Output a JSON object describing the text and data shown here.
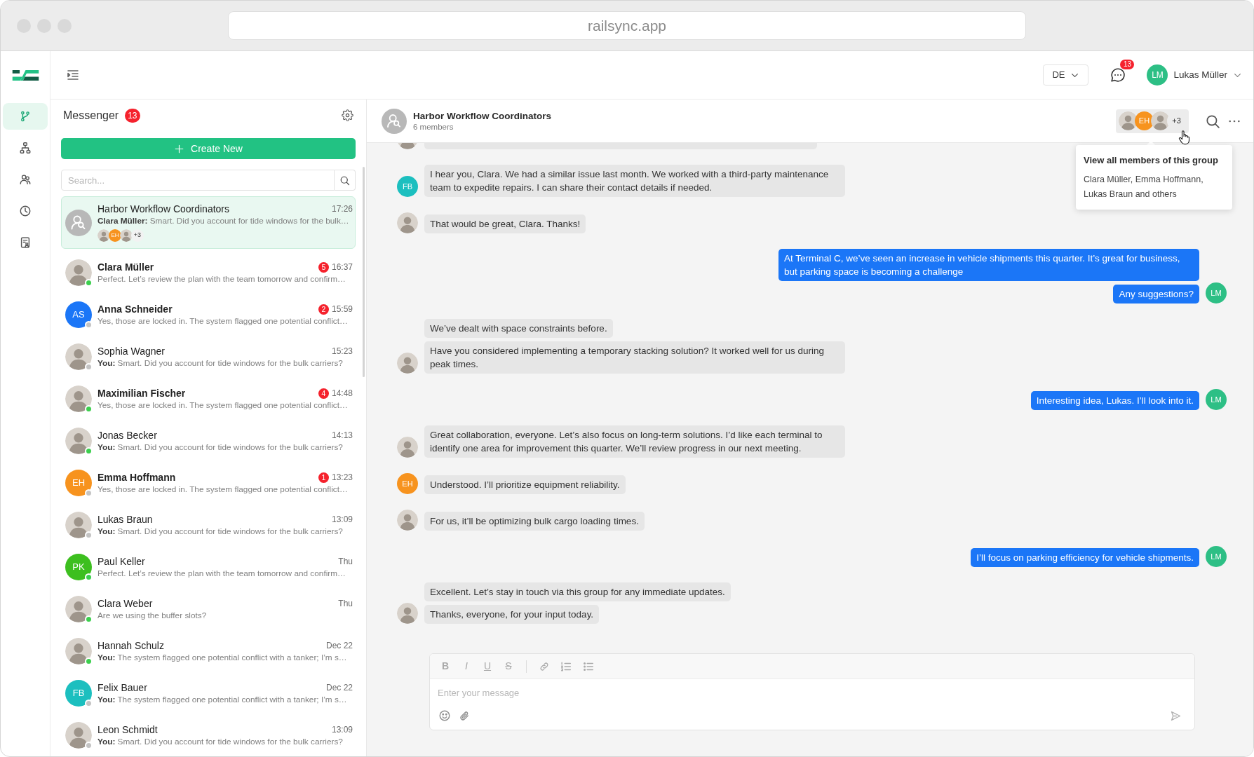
{
  "browser": {
    "url": "railsync.app"
  },
  "nav_rail": {
    "items": [
      {
        "selected": true
      },
      {
        "selected": false
      },
      {
        "selected": false
      },
      {
        "selected": false
      },
      {
        "selected": false
      }
    ]
  },
  "top_bar": {
    "language": "DE",
    "notifications": "13",
    "user": {
      "initials": "LM",
      "name": "Lukas Müller"
    }
  },
  "messenger": {
    "title": "Messenger",
    "unread": "13",
    "create_label": "Create New",
    "search": {
      "placeholder": "Search..."
    },
    "conversations": [
      {
        "kind": "group",
        "selected": true,
        "name": "Harbor Workflow Coordinators",
        "time": "17:26",
        "preview": "**Clara Müller:** Smart. Did you account for tide windows for the bulk…",
        "avatar": {
          "kind": "group"
        },
        "members_preview": {
          "avatars": [
            {
              "kind": "photo"
            },
            {
              "kind": "initials",
              "initials": "EH",
              "color": "#f7931e"
            },
            {
              "kind": "photo"
            }
          ],
          "more": "+3"
        }
      },
      {
        "kind": "direct",
        "selected": false,
        "online": true,
        "name": "Clara Müller",
        "unread": "5",
        "time": "16:37",
        "preview": "Perfect. Let’s review the plan with the team tomorrow and confirm…",
        "avatar": {
          "kind": "photo"
        }
      },
      {
        "kind": "direct",
        "selected": false,
        "online": false,
        "name": "Anna Schneider",
        "unread": "2",
        "time": "15:59",
        "preview": "Yes, those are locked in. The system flagged one potential conflict…",
        "avatar": {
          "kind": "initials",
          "initials": "AS",
          "color": "#1b76f7"
        }
      },
      {
        "kind": "direct",
        "selected": false,
        "online": false,
        "name": "Sophia Wagner",
        "time": "15:23",
        "preview": "**You:** Smart. Did you account for tide windows for the bulk carriers?",
        "avatar": {
          "kind": "photo"
        }
      },
      {
        "kind": "direct",
        "selected": false,
        "online": true,
        "name": "Maximilian Fischer",
        "unread": "4",
        "time": "14:48",
        "preview": "Yes, those are locked in. The system flagged one potential conflict…",
        "avatar": {
          "kind": "photo"
        }
      },
      {
        "kind": "direct",
        "selected": false,
        "online": true,
        "name": "Jonas Becker",
        "time": "14:13",
        "preview": "**You:** Smart. Did you account for tide windows for the bulk carriers?",
        "avatar": {
          "kind": "photo"
        }
      },
      {
        "kind": "direct",
        "selected": false,
        "online": false,
        "name": "Emma Hoffmann",
        "unread": "1",
        "time": "13:23",
        "preview": "Yes, those are locked in. The system flagged one potential conflict…",
        "avatar": {
          "kind": "initials",
          "initials": "EH",
          "color": "#f7931e"
        }
      },
      {
        "kind": "direct",
        "selected": false,
        "online": false,
        "name": "Lukas Braun",
        "time": "13:09",
        "preview": "**You:** Smart. Did you account for tide windows for the bulk carriers?",
        "avatar": {
          "kind": "photo"
        }
      },
      {
        "kind": "direct",
        "selected": false,
        "online": true,
        "name": "Paul Keller",
        "time": "Thu",
        "preview": "Perfect. Let’s review the plan with the team tomorrow and confirm…",
        "avatar": {
          "kind": "initials",
          "initials": "PK",
          "color": "#3dbf1f"
        }
      },
      {
        "kind": "direct",
        "selected": false,
        "online": true,
        "name": "Clara Weber",
        "time": "Thu",
        "preview": "Are we using the buffer slots?",
        "avatar": {
          "kind": "photo"
        }
      },
      {
        "kind": "direct",
        "selected": false,
        "online": true,
        "name": "Hannah Schulz",
        "time": "Dec 22",
        "preview": "**You:** The system flagged one potential conflict with a tanker; I’m s…",
        "avatar": {
          "kind": "photo"
        }
      },
      {
        "kind": "direct",
        "selected": false,
        "online": false,
        "name": "Felix Bauer",
        "time": "Dec 22",
        "preview": "**You:** The system flagged one potential conflict with a tanker; I’m s…",
        "avatar": {
          "kind": "initials",
          "initials": "FB",
          "color": "#1cbfbf"
        }
      },
      {
        "kind": "direct",
        "selected": false,
        "online": false,
        "name": "Leon Schmidt",
        "time": "13:09",
        "preview": "**You:** Smart. Did you account for tide windows for the bulk carriers?",
        "avatar": {
          "kind": "photo"
        }
      }
    ]
  },
  "chat": {
    "title": "Harbor Workflow Coordinators",
    "subtitle": "6 members",
    "members": {
      "avatars": [
        {
          "kind": "photo"
        },
        {
          "kind": "initials",
          "initials": "EH",
          "color": "#f7931e"
        },
        {
          "kind": "photo"
        }
      ],
      "more": "+3"
    },
    "tooltip": {
      "title": "View all members of this group",
      "text": "Clara Müller, Emma Hoffmann, Lukas Braun and others"
    },
    "message_groups": [
      {
        "kind": "cut_off",
        "outgoing": false,
        "avatar": {
          "kind": "photo"
        }
      },
      {
        "kind": "full",
        "outgoing": false,
        "avatar": {
          "kind": "initials",
          "initials": "FB",
          "color": "#1cbfbf"
        },
        "bubbles": [
          "I hear you, Clara. We had a similar issue last month. We worked with a third-party maintenance team to expedite repairs. I can share their contact details if needed."
        ]
      },
      {
        "kind": "full",
        "outgoing": false,
        "avatar": {
          "kind": "photo"
        },
        "bubbles": [
          "That would be great, Clara. Thanks!"
        ]
      },
      {
        "kind": "full",
        "outgoing": true,
        "avatar": {
          "kind": "initials",
          "initials": "LM",
          "color": "#2dbf85"
        },
        "bubbles": [
          "At Terminal C, we’ve seen an increase in vehicle shipments this quarter. It’s great for business, but parking space is becoming a challenge",
          "Any suggestions?"
        ]
      },
      {
        "kind": "full",
        "outgoing": false,
        "avatar": {
          "kind": "photo"
        },
        "bubbles": [
          "We’ve dealt with space constraints before.",
          "Have you considered implementing a temporary stacking solution? It worked well for us during peak times."
        ]
      },
      {
        "kind": "full",
        "outgoing": true,
        "avatar": {
          "kind": "initials",
          "initials": "LM",
          "color": "#2dbf85"
        },
        "bubbles": [
          "Interesting idea, Lukas. I’ll look into it."
        ]
      },
      {
        "kind": "full",
        "outgoing": false,
        "avatar": {
          "kind": "photo"
        },
        "bubbles": [
          "Great collaboration, everyone. Let’s also focus on long-term solutions. I’d like each terminal to identify one area for improvement this quarter. We’ll review progress in our next meeting."
        ]
      },
      {
        "kind": "full",
        "outgoing": false,
        "avatar": {
          "kind": "initials",
          "initials": "EH",
          "color": "#f7931e"
        },
        "bubbles": [
          "Understood. I’ll prioritize equipment reliability."
        ]
      },
      {
        "kind": "full",
        "outgoing": false,
        "avatar": {
          "kind": "photo"
        },
        "bubbles": [
          "For us, it’ll be optimizing bulk cargo loading times."
        ]
      },
      {
        "kind": "full",
        "outgoing": true,
        "avatar": {
          "kind": "initials",
          "initials": "LM",
          "color": "#2dbf85"
        },
        "bubbles": [
          "I’ll focus on parking efficiency for vehicle shipments."
        ]
      },
      {
        "kind": "full",
        "outgoing": false,
        "avatar": {
          "kind": "photo"
        },
        "bubbles": [
          "Excellent. Let’s stay in touch via this group for any immediate updates.",
          "Thanks, everyone, for your input today."
        ]
      }
    ],
    "composer": {
      "format_buttons": [
        {
          "kind": "bold",
          "label": "B"
        },
        {
          "kind": "italic",
          "label": "I"
        },
        {
          "kind": "underline",
          "label": "U"
        },
        {
          "kind": "strike",
          "label": "S"
        }
      ],
      "placeholder": "Enter your message"
    }
  }
}
